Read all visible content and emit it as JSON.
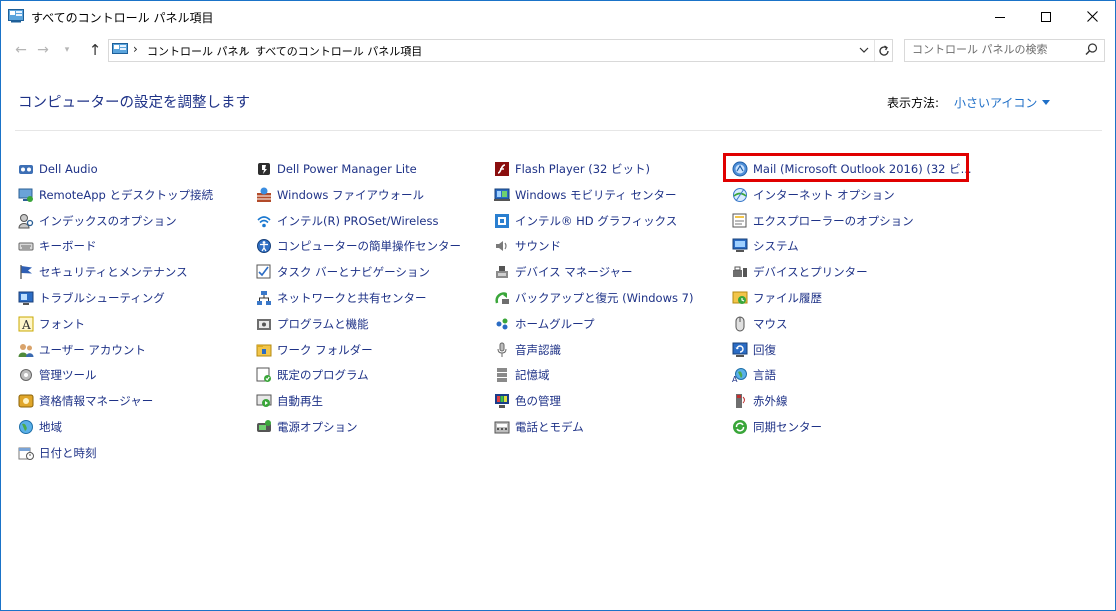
{
  "window": {
    "title": "すべてのコントロール パネル項目"
  },
  "address": {
    "crumbs": [
      "コントロール パネル",
      "すべてのコントロール パネル項目"
    ]
  },
  "search": {
    "placeholder": "コントロール パネルの検索"
  },
  "header": {
    "title": "コンピューターの設定を調整します",
    "view_by_label": "表示方法:",
    "view_mode": "小さいアイコン"
  },
  "columns": [
    [
      {
        "label": "Dell Audio",
        "icon": "audio-icon"
      },
      {
        "label": "RemoteApp とデスクトップ接続",
        "icon": "remoteapp-icon"
      },
      {
        "label": "インデックスのオプション",
        "icon": "indexing-icon"
      },
      {
        "label": "キーボード",
        "icon": "keyboard-icon"
      },
      {
        "label": "セキュリティとメンテナンス",
        "icon": "flag-icon"
      },
      {
        "label": "トラブルシューティング",
        "icon": "troubleshoot-icon"
      },
      {
        "label": "フォント",
        "icon": "font-icon"
      },
      {
        "label": "ユーザー アカウント",
        "icon": "users-icon"
      },
      {
        "label": "管理ツール",
        "icon": "admin-tools-icon"
      },
      {
        "label": "資格情報マネージャー",
        "icon": "credential-icon"
      },
      {
        "label": "地域",
        "icon": "region-icon"
      },
      {
        "label": "日付と時刻",
        "icon": "clock-icon"
      }
    ],
    [
      {
        "label": "Dell Power Manager Lite",
        "icon": "battery-icon"
      },
      {
        "label": "Windows ファイアウォール",
        "icon": "firewall-icon"
      },
      {
        "label": "インテル(R) PROSet/Wireless",
        "icon": "wireless-icon"
      },
      {
        "label": "コンピューターの簡単操作センター",
        "icon": "ease-of-access-icon"
      },
      {
        "label": "タスク バーとナビゲーション",
        "icon": "taskbar-icon"
      },
      {
        "label": "ネットワークと共有センター",
        "icon": "network-icon"
      },
      {
        "label": "プログラムと機能",
        "icon": "programs-icon"
      },
      {
        "label": "ワーク フォルダー",
        "icon": "work-folder-icon"
      },
      {
        "label": "既定のプログラム",
        "icon": "default-programs-icon"
      },
      {
        "label": "自動再生",
        "icon": "autoplay-icon"
      },
      {
        "label": "電源オプション",
        "icon": "power-icon"
      }
    ],
    [
      {
        "label": "Flash Player (32 ビット)",
        "icon": "flash-icon"
      },
      {
        "label": "Windows モビリティ センター",
        "icon": "mobility-icon"
      },
      {
        "label": "インテル® HD グラフィックス",
        "icon": "graphics-icon"
      },
      {
        "label": "サウンド",
        "icon": "speaker-icon"
      },
      {
        "label": "デバイス マネージャー",
        "icon": "device-manager-icon"
      },
      {
        "label": "バックアップと復元 (Windows 7)",
        "icon": "backup-icon"
      },
      {
        "label": "ホームグループ",
        "icon": "homegroup-icon"
      },
      {
        "label": "音声認識",
        "icon": "microphone-icon"
      },
      {
        "label": "記憶域",
        "icon": "storage-icon"
      },
      {
        "label": "色の管理",
        "icon": "color-icon"
      },
      {
        "label": "電話とモデム",
        "icon": "phone-icon"
      }
    ],
    [
      {
        "label": "Mail (Microsoft Outlook 2016) (32 ビ...",
        "icon": "mail-icon"
      },
      {
        "label": "インターネット オプション",
        "icon": "internet-icon"
      },
      {
        "label": "エクスプローラーのオプション",
        "icon": "explorer-options-icon"
      },
      {
        "label": "システム",
        "icon": "system-icon"
      },
      {
        "label": "デバイスとプリンター",
        "icon": "printer-icon"
      },
      {
        "label": "ファイル履歴",
        "icon": "file-history-icon"
      },
      {
        "label": "マウス",
        "icon": "mouse-icon"
      },
      {
        "label": "回復",
        "icon": "recovery-icon"
      },
      {
        "label": "言語",
        "icon": "language-icon"
      },
      {
        "label": "赤外線",
        "icon": "infrared-icon"
      },
      {
        "label": "同期センター",
        "icon": "sync-icon"
      }
    ]
  ],
  "highlight_target": "Mail (Microsoft Outlook 2016) (32 ビ...",
  "colors": {
    "link": "#1e3287",
    "heading": "#1e3287",
    "view_mode": "#1f6fc7",
    "highlight_border": "#e00000"
  }
}
